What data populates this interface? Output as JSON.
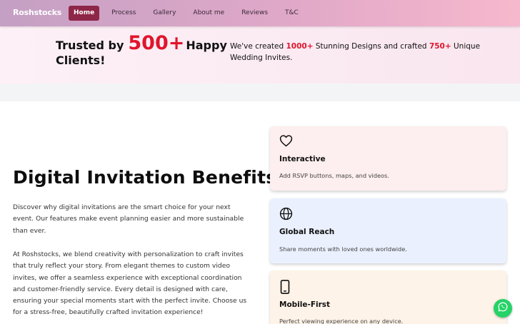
{
  "navbar": {
    "brand": "Roshstocks",
    "links": [
      {
        "label": "Home",
        "active": true
      },
      {
        "label": "Process"
      },
      {
        "label": "Gallery"
      },
      {
        "label": "About me"
      },
      {
        "label": "Reviews"
      },
      {
        "label": "T&C"
      }
    ]
  },
  "trust": {
    "title_prefix": "Trusted by",
    "client_count": "500+",
    "title_suffix": "Happy",
    "title_line2": "Clients!",
    "stats": {
      "text_1": "We've created ",
      "designs_count": "1000+",
      "text_2": " Stunning Designs and crafted ",
      "invites_count": "750+",
      "text_3": " Unique Wedding Invites."
    }
  },
  "benefits": {
    "title": "Digital Invitation Benefits",
    "paragraph_1": "Discover why digital invitations are the smart choice for your next event. Our features make event planning easier and more sustainable than ever.",
    "paragraph_2": "At Roshstocks, we blend creativity with personalization to craft invites that truly reflect your story. From elegant themes to custom video invites, we offer a seamless experience with exceptional coordination and customer-friendly service. Every detail is designed with care, ensuring your special moments start with the perfect invite. Choose us for a stress-free, beautifully crafted invitation experience!",
    "cards": [
      {
        "icon": "heart-icon",
        "title": "Interactive",
        "description": "Add RSVP buttons, maps, and videos.",
        "bg": "#fdeeef"
      },
      {
        "icon": "globe-icon",
        "title": "Global Reach",
        "description": "Share moments with loved ones worldwide.",
        "bg": "#eaf0fd"
      },
      {
        "icon": "mobile-icon",
        "title": "Mobile-First",
        "description": "Perfect viewing experience on any device.",
        "bg": "#fef3e8"
      }
    ]
  },
  "fab": {
    "icon": "whatsapp-icon",
    "color": "#25d366"
  },
  "colors": {
    "accent": "#e0152c",
    "nav_active": "#8e2648"
  }
}
